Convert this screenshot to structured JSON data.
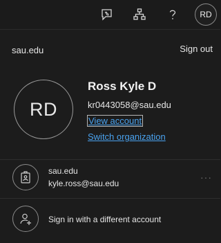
{
  "topbar": {
    "icons": [
      "feedback-icon",
      "org-chart-icon",
      "help-icon"
    ],
    "avatar_initials": "RD"
  },
  "panel": {
    "org_name": "sau.edu",
    "sign_out_label": "Sign out",
    "profile": {
      "initials": "RD",
      "name": "Ross Kyle D",
      "email": "kr0443058@sau.edu",
      "view_account_label": "View account",
      "switch_org_label": "Switch organization"
    },
    "other_accounts": [
      {
        "org": "sau.edu",
        "email": "kyle.ross@sau.edu",
        "icon": "id-badge-icon",
        "more_label": "···"
      }
    ],
    "add_account": {
      "icon": "add-person-icon",
      "label": "Sign in with a different account"
    }
  },
  "colors": {
    "background": "#1b1b1b",
    "link": "#4aa3f0",
    "text": "#e6e6e6"
  }
}
